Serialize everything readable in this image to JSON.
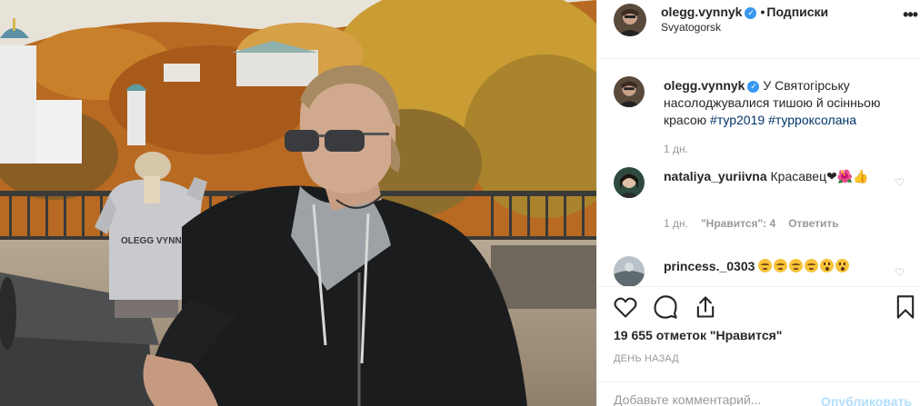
{
  "post": {
    "username": "olegg.vynnyk",
    "follow_label": "Подписки",
    "location": "Svyatogorsk",
    "more_label": "•••",
    "jacket_text": "OLEGG VYNNYK",
    "caption_user": "olegg.vynnyk",
    "caption_text": " У Святогірську насолоджувалися тишою й осінньою красою ",
    "caption_tag1": "#тур2019",
    "caption_tag2": "#турроксолана",
    "caption_time": "1 дн.",
    "likes_text": "19 655 отметок \"Нравится\"",
    "posted_text": "ДЕНЬ НАЗАД",
    "comment_placeholder": "Добавьте комментарий...",
    "publish_label": "Опубликовать"
  },
  "comments": [
    {
      "username": "nataliya_yuriivna",
      "text": "Красавец",
      "emoji": "❤🌺👍",
      "time": "1 дн.",
      "likes": "\"Нравится\": 4",
      "reply": "Ответить"
    },
    {
      "username": "princess._0303",
      "emoji": [
        "cry",
        "cry",
        "cry",
        "cry",
        "wow",
        "wow"
      ]
    }
  ],
  "icons": {
    "like": "heart-icon",
    "comment": "comment-bubble-icon",
    "share": "share-icon",
    "save": "bookmark-icon"
  },
  "colors": {
    "verified": "#3897f0",
    "hashtag": "#003569",
    "publish": "#b2dffc"
  }
}
